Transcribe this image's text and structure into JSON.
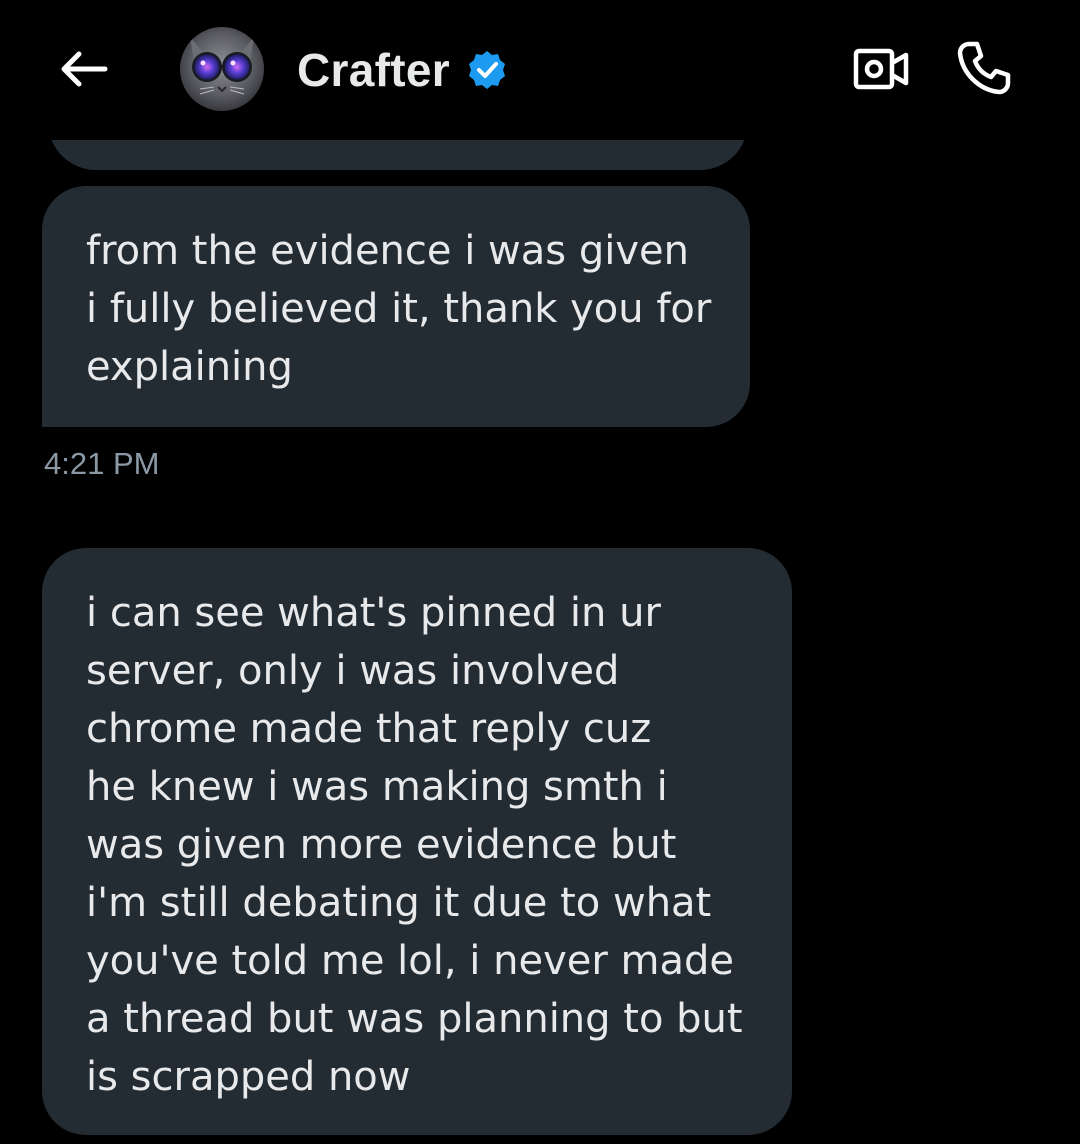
{
  "header": {
    "back_icon": "arrow-left-icon",
    "contact_name": "Crafter",
    "verified_icon": "verified-badge-icon",
    "video_icon": "video-camera-icon",
    "call_icon": "phone-icon"
  },
  "messages": [
    {
      "lines": [
        "from the evidence i was given",
        "i fully believed it, thank you for",
        "explaining"
      ],
      "timestamp": "4:21 PM"
    },
    {
      "lines": [
        "i can see what's pinned in ur",
        "server, only i was involved",
        "chrome made that reply cuz",
        "he knew i was making smth i",
        "was given more evidence but",
        "i'm still debating it due to what",
        "you've told me lol, i never made",
        "a thread but was planning to but",
        "is scrapped now"
      ]
    }
  ],
  "colors": {
    "background": "#000000",
    "bubble": "#232b33",
    "text": "#e7e9ea",
    "muted": "#8b98a5",
    "verified": "#1d9bf0"
  }
}
